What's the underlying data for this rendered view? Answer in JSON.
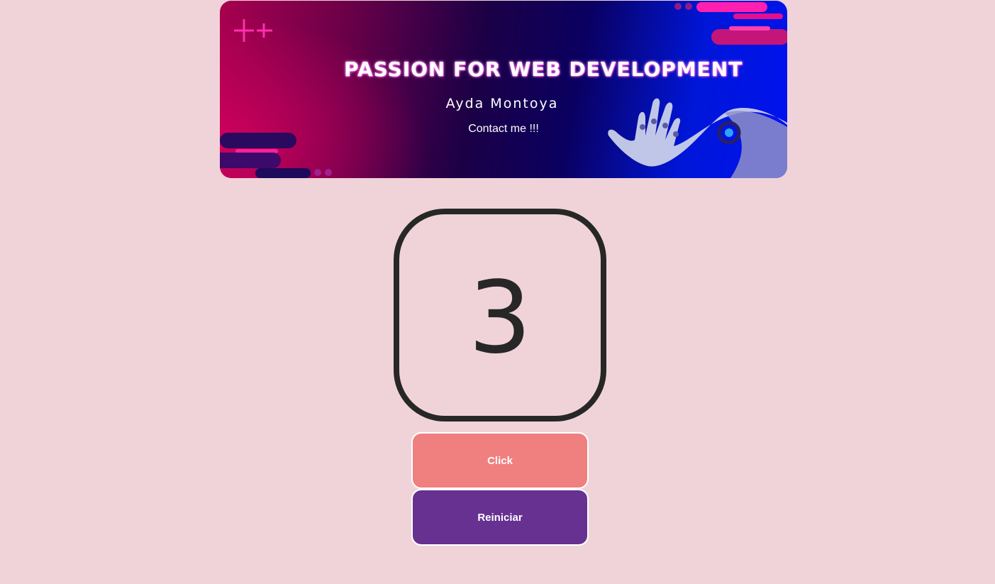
{
  "banner": {
    "title": "PASSION FOR WEB DEVELOPMENT",
    "name": "Ayda Montoya",
    "contact_label": "Contact me !!!"
  },
  "counter": {
    "value": "3"
  },
  "buttons": {
    "click_label": "Click",
    "reset_label": "Reiniciar"
  },
  "colors": {
    "page_background": "#f0d3d8",
    "counter_border": "#272727",
    "click_button": "#ef807f",
    "reset_button": "#663191"
  },
  "icons": [
    "robot-hand-image",
    "plus-decoration-icon"
  ]
}
